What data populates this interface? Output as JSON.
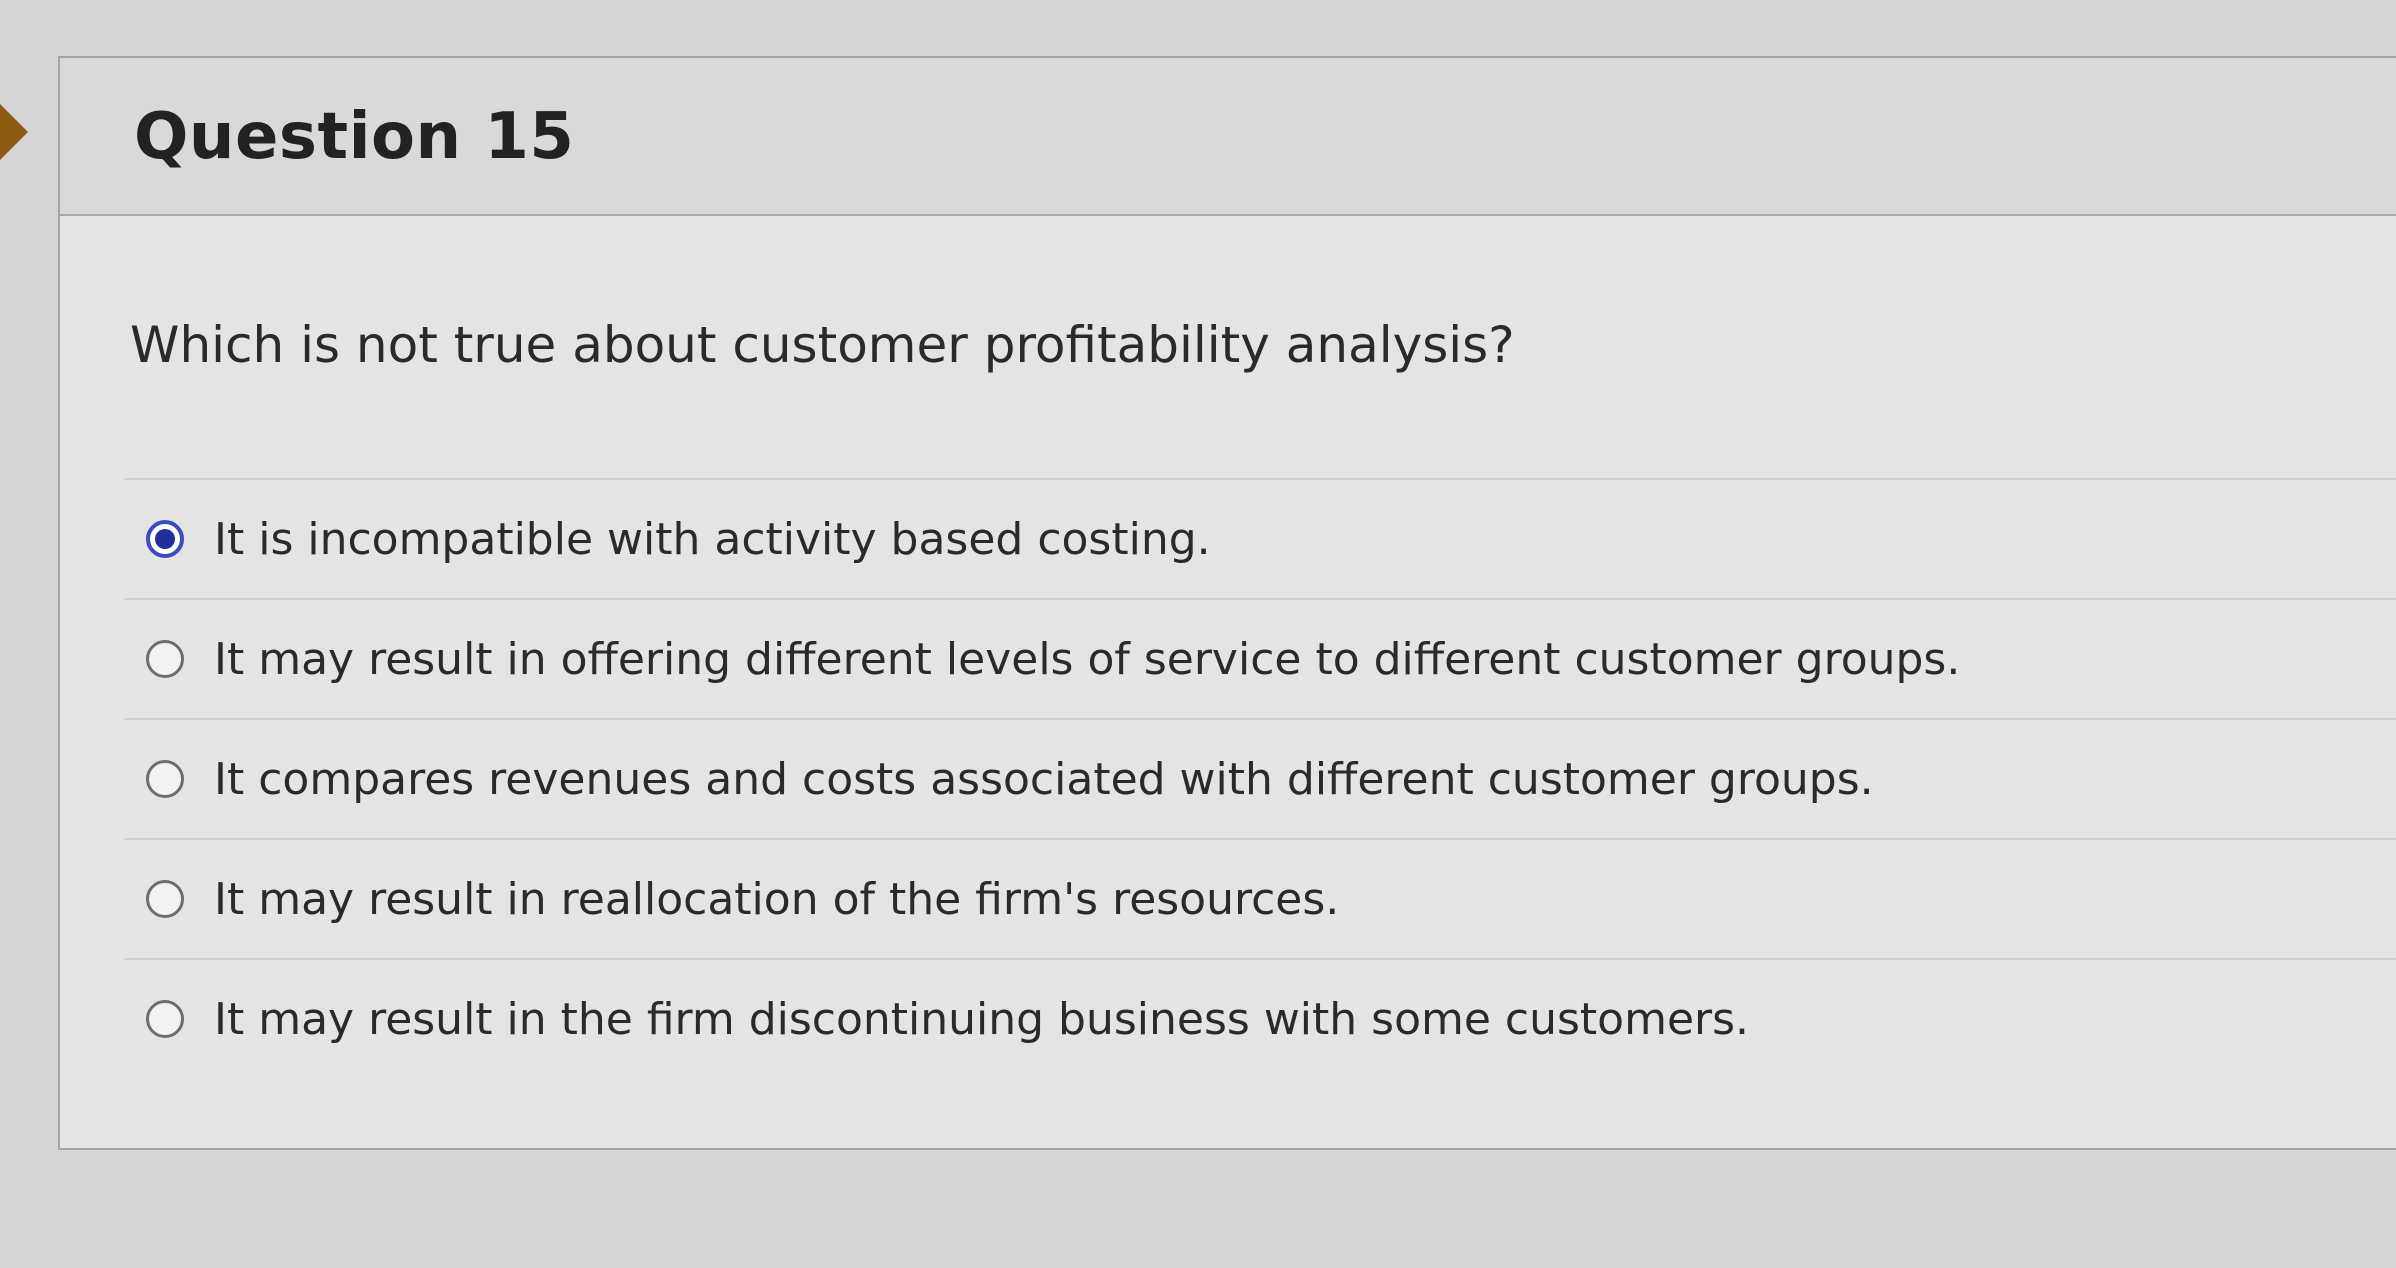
{
  "question": {
    "title": "Question 15",
    "prompt": "Which is not true about customer profitability analysis?",
    "answers": [
      {
        "label": "It is incompatible with activity based costing.",
        "selected": true
      },
      {
        "label": "It may result in offering different levels of service to different customer groups.",
        "selected": false
      },
      {
        "label": "It compares revenues and costs associated with different customer groups.",
        "selected": false
      },
      {
        "label": "It may result in reallocation of the firm's resources.",
        "selected": false
      },
      {
        "label": "It may result in the firm discontinuing business with some customers.",
        "selected": false
      }
    ]
  },
  "colors": {
    "selected_radio": "#1f2f9e",
    "flag_marker": "#8a5b10"
  }
}
